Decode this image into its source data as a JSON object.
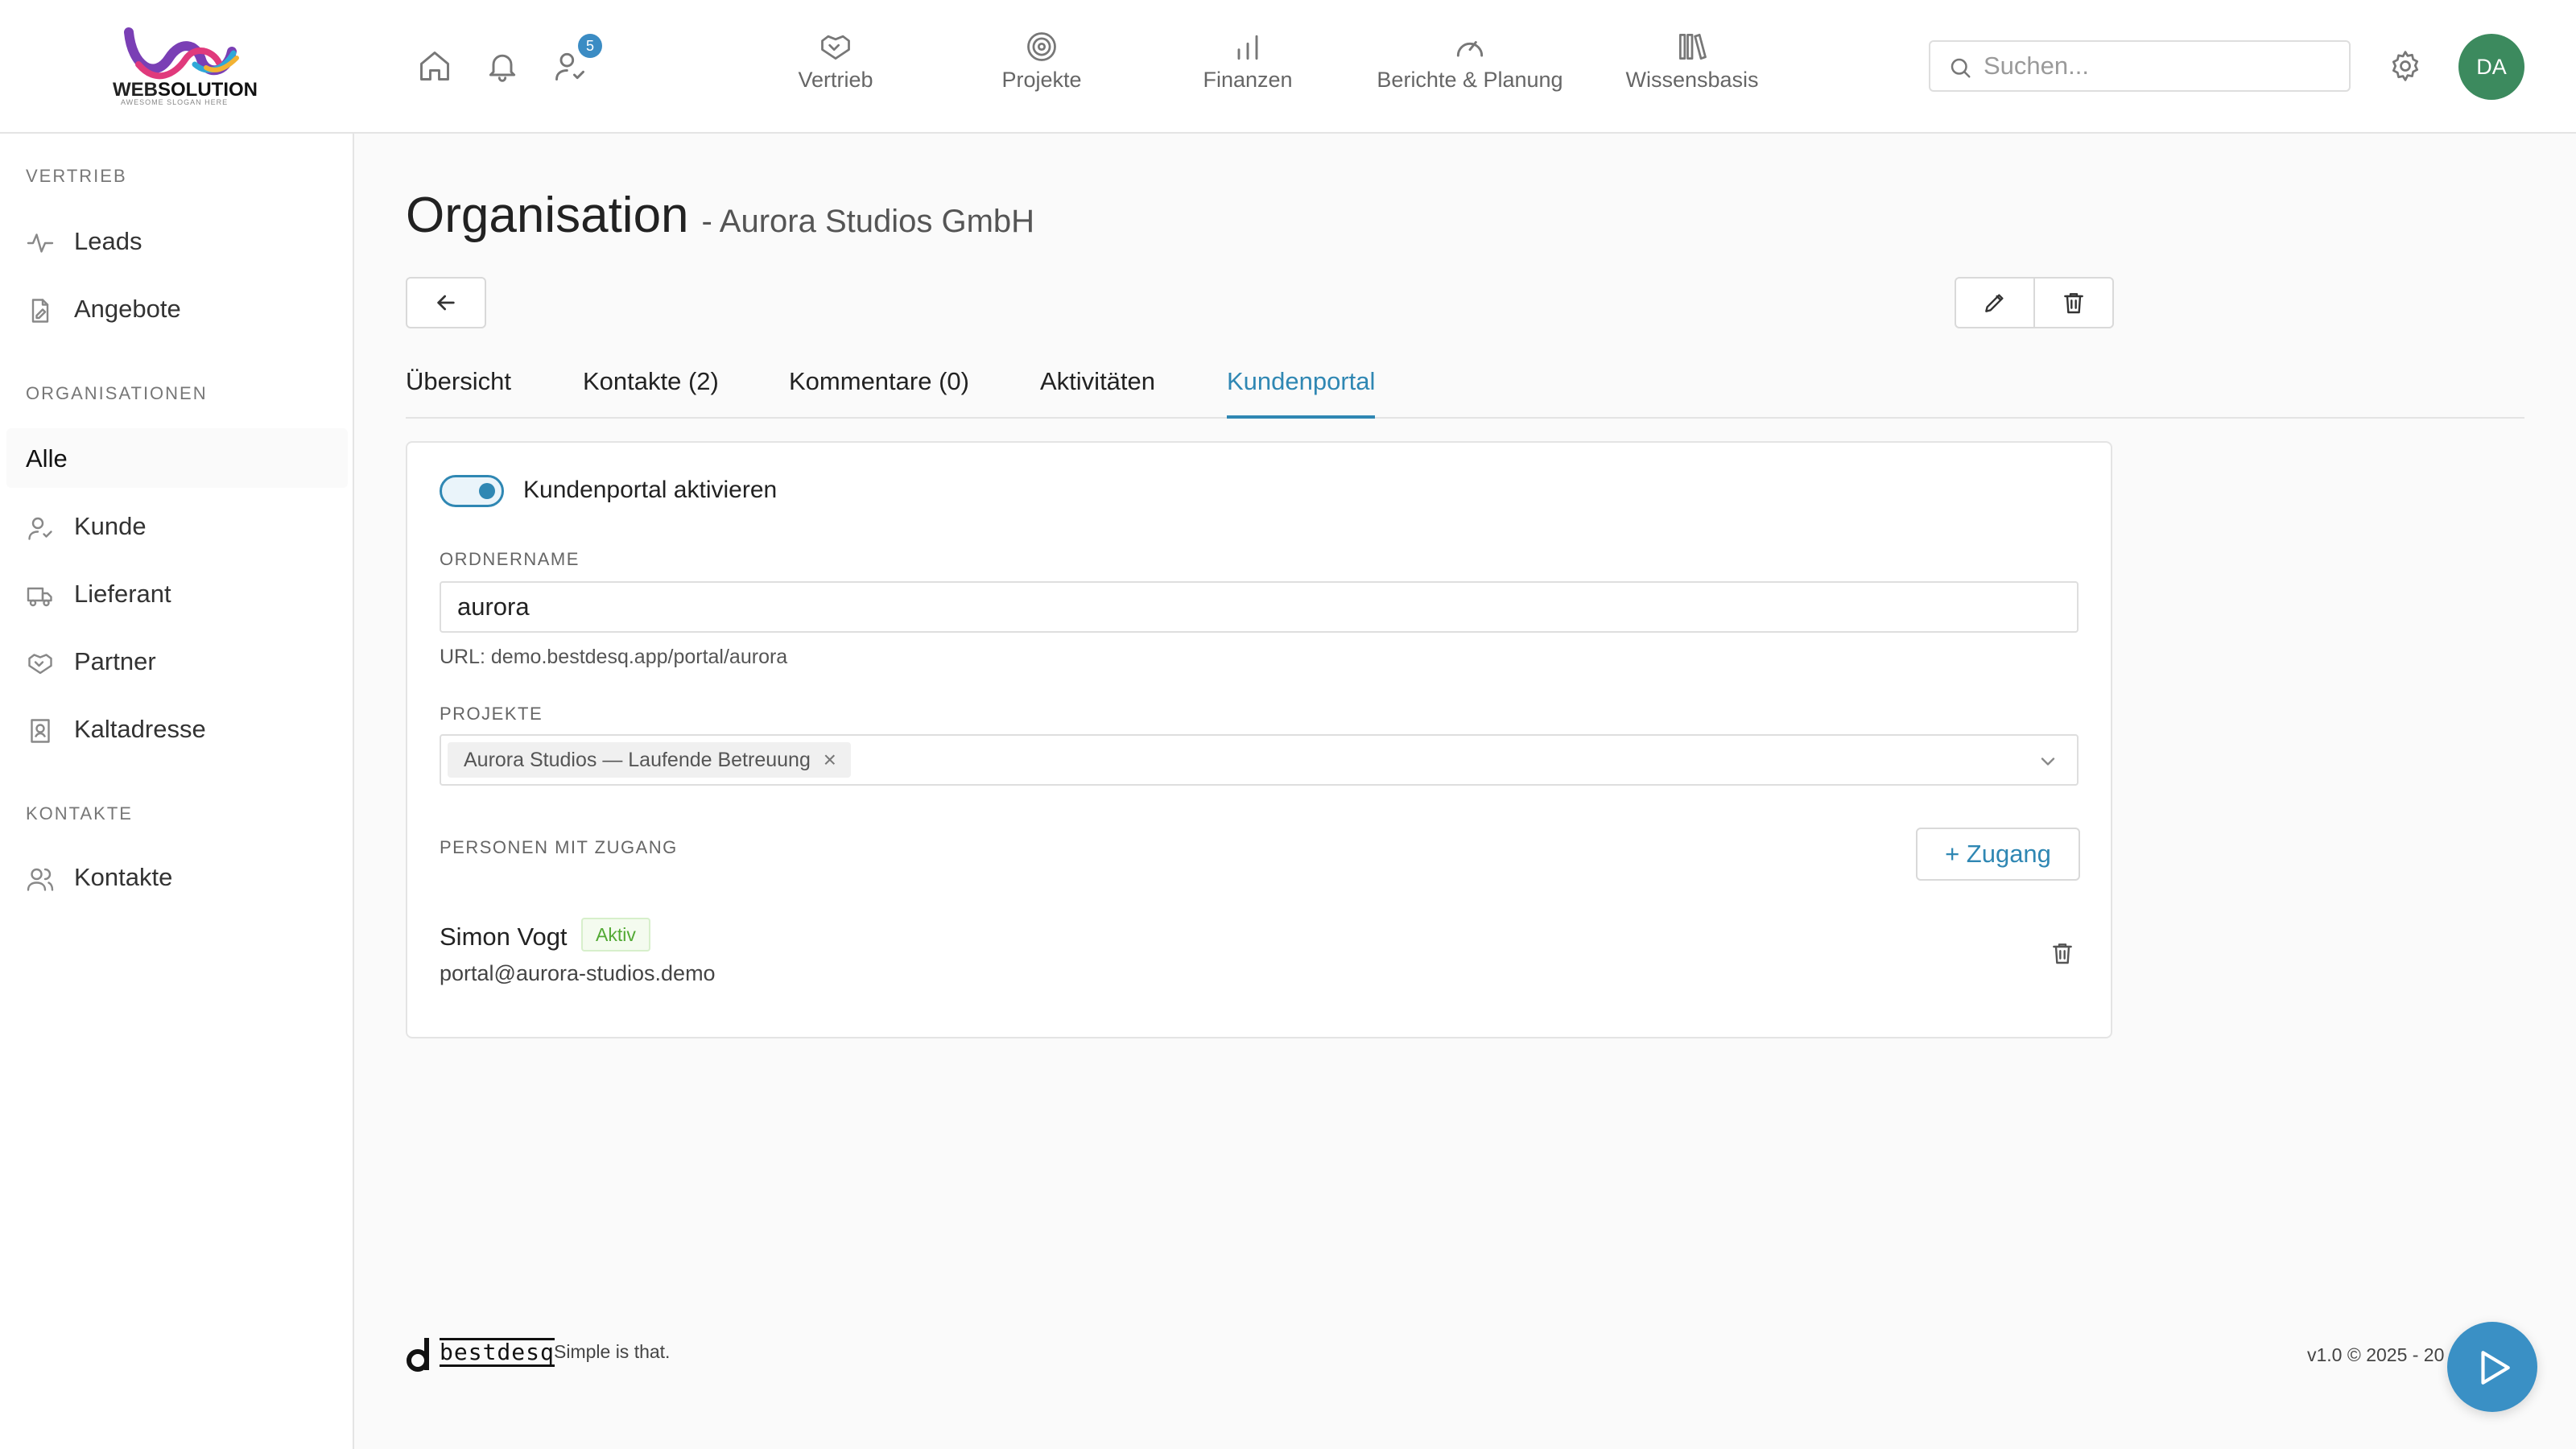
{
  "brand": {
    "name_part1": "WEB",
    "name_part2": "SOLUTION",
    "tagline": "AWESOME SLOGAN HERE"
  },
  "topbar": {
    "notification_badge": "5",
    "nav": [
      {
        "label": "Vertrieb",
        "icon": "handshake-icon"
      },
      {
        "label": "Projekte",
        "icon": "target-icon"
      },
      {
        "label": "Finanzen",
        "icon": "bar-chart-icon"
      },
      {
        "label": "Berichte & Planung",
        "icon": "gauge-icon"
      },
      {
        "label": "Wissensbasis",
        "icon": "library-icon"
      }
    ],
    "search_placeholder": "Suchen...",
    "avatar_initials": "DA",
    "avatar_color": "#3c8a5e"
  },
  "sidebar": {
    "sections": [
      {
        "title": "VERTRIEB",
        "items": [
          {
            "label": "Leads"
          },
          {
            "label": "Angebote"
          }
        ]
      },
      {
        "title": "ORGANISATIONEN",
        "items": [
          {
            "label": "Alle"
          },
          {
            "label": "Kunde"
          },
          {
            "label": "Lieferant"
          },
          {
            "label": "Partner"
          },
          {
            "label": "Kaltadresse"
          }
        ]
      },
      {
        "title": "KONTAKTE",
        "items": [
          {
            "label": "Kontakte"
          }
        ]
      }
    ]
  },
  "page": {
    "title": "Organisation",
    "subtitle": "- Aurora Studios GmbH",
    "tabs": [
      {
        "label": "Übersicht"
      },
      {
        "label": "Kontakte (2)"
      },
      {
        "label": "Kommentare (0)"
      },
      {
        "label": "Aktivitäten"
      },
      {
        "label": "Kundenportal",
        "active": true
      }
    ]
  },
  "portal": {
    "toggle_label": "Kundenportal aktivieren",
    "toggle_on": true,
    "folder_label": "ORDNERNAME",
    "folder_value": "aurora",
    "url_hint": "URL: demo.bestdesq.app/portal/aurora",
    "projects_label": "PROJEKTE",
    "projects_selected": "Aurora Studios — Laufende Betreuung",
    "persons_label": "PERSONEN MIT ZUGANG",
    "add_access_label": "+ Zugang",
    "person": {
      "name": "Simon Vogt",
      "status": "Aktiv",
      "email": "portal@aurora-studios.demo"
    }
  },
  "footer": {
    "brand": "bestdesq",
    "tagline": "Simple is that.",
    "version": "v1.0 © 2025 - 20"
  },
  "colors": {
    "accent": "#2f87b3",
    "status_active": "#52a934",
    "fab": "#3a90c5"
  }
}
